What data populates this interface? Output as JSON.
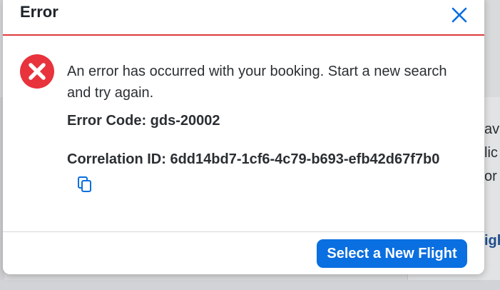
{
  "background": {
    "side_text_lines": [
      "av",
      "lic",
      "or"
    ],
    "side_link": "igh"
  },
  "modal": {
    "title": "Error",
    "message": "An error has occurred with your booking. Start a new search and try again.",
    "error_code": "Error Code: gds-20002",
    "correlation_id": "Correlation ID: 6dd14bd7-1cf6-4c79-b693-efb42d67f7b0",
    "primary_button": "Select a New Flight"
  },
  "icons": {
    "close": "close-icon",
    "error": "error-circle-x-icon",
    "copy": "copy-icon"
  },
  "colors": {
    "accent": "#0a6fe0",
    "error": "#e8323c",
    "header_rule": "#e03a3a",
    "text": "#2b2f33"
  }
}
